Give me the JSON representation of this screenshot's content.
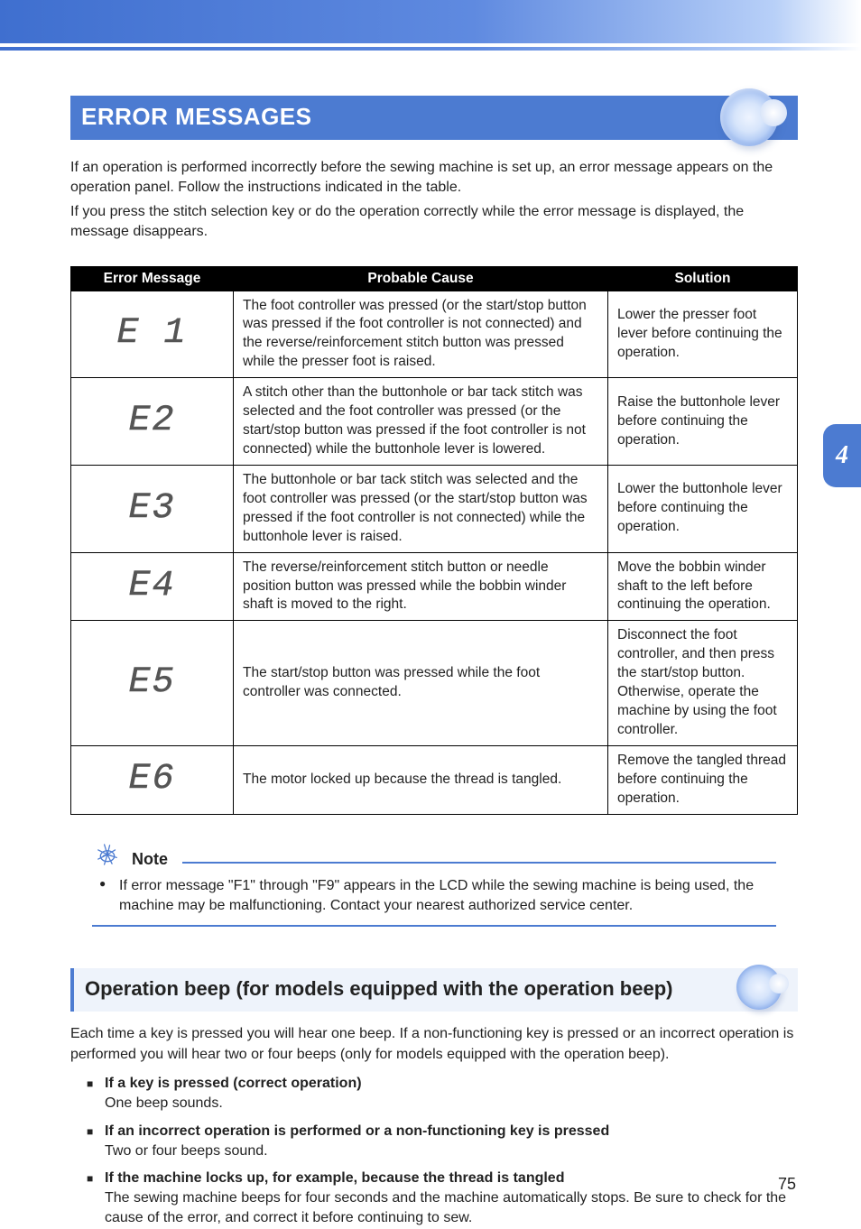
{
  "section_tab": "4",
  "page_number": "75",
  "h1": "ERROR MESSAGES",
  "intro": {
    "p1": "If an operation is performed incorrectly before the sewing machine is set up, an error message appears on the operation panel. Follow the instructions indicated in the table.",
    "p2": "If you press the stitch selection key or do the operation correctly while the error message is displayed, the message disappears."
  },
  "table": {
    "headers": {
      "col1": "Error Message",
      "col2": "Probable Cause",
      "col3": "Solution"
    },
    "rows": [
      {
        "code": "E1",
        "seg": "E 1",
        "cause": "The foot controller was pressed (or the start/stop button was pressed if the foot controller is not connected) and the reverse/reinforcement stitch button was pressed while the presser foot is raised.",
        "solution": "Lower the presser foot lever before continuing the operation."
      },
      {
        "code": "E2",
        "seg": "E2",
        "cause": "A stitch other than the buttonhole or bar tack stitch was selected and the foot controller was pressed (or the start/stop button was pressed if the foot controller is not connected) while the buttonhole lever is lowered.",
        "solution": "Raise the buttonhole lever before continuing the operation."
      },
      {
        "code": "E3",
        "seg": "E3",
        "cause": "The buttonhole or bar tack stitch was selected and the foot controller was pressed (or the start/stop button was pressed if the foot controller is not connected) while the buttonhole lever is raised.",
        "solution": "Lower the buttonhole lever before continuing the operation."
      },
      {
        "code": "E4",
        "seg": "E4",
        "cause": "The reverse/reinforcement stitch button or needle position button was pressed while the bobbin winder shaft is moved to the right.",
        "solution": "Move the bobbin winder shaft to the left before continuing the operation."
      },
      {
        "code": "E5",
        "seg": "E5",
        "cause": "The start/stop button was pressed while the foot controller was connected.",
        "solution": "Disconnect the foot controller, and then press the start/stop button. Otherwise, operate the machine by using the foot controller."
      },
      {
        "code": "E6",
        "seg": "E6",
        "cause": "The motor locked up because the thread is tangled.",
        "solution": "Remove the tangled thread before continuing the operation."
      }
    ]
  },
  "note": {
    "label": "Note",
    "text": "If error message \"F1\" through \"F9\" appears in the LCD while the sewing machine is being used, the machine may be malfunctioning. Contact your nearest authorized service center."
  },
  "h2": "Operation beep (for models equipped with the operation beep)",
  "beep_intro": "Each time a key is pressed you will hear one beep. If a non-functioning key is pressed or an incorrect operation is performed you will hear two or four beeps (only for models equipped with the operation beep).",
  "bullets": [
    {
      "title": "If a key is pressed (correct operation)",
      "body": "One beep sounds."
    },
    {
      "title": "If an incorrect operation is performed or a non-functioning key is pressed",
      "body": "Two or four beeps sound."
    },
    {
      "title": "If the machine locks up, for example, because the thread is tangled",
      "body": "The sewing machine beeps for four seconds and the machine automatically stops. Be sure to check for the cause of the error, and correct it before continuing to sew."
    }
  ]
}
